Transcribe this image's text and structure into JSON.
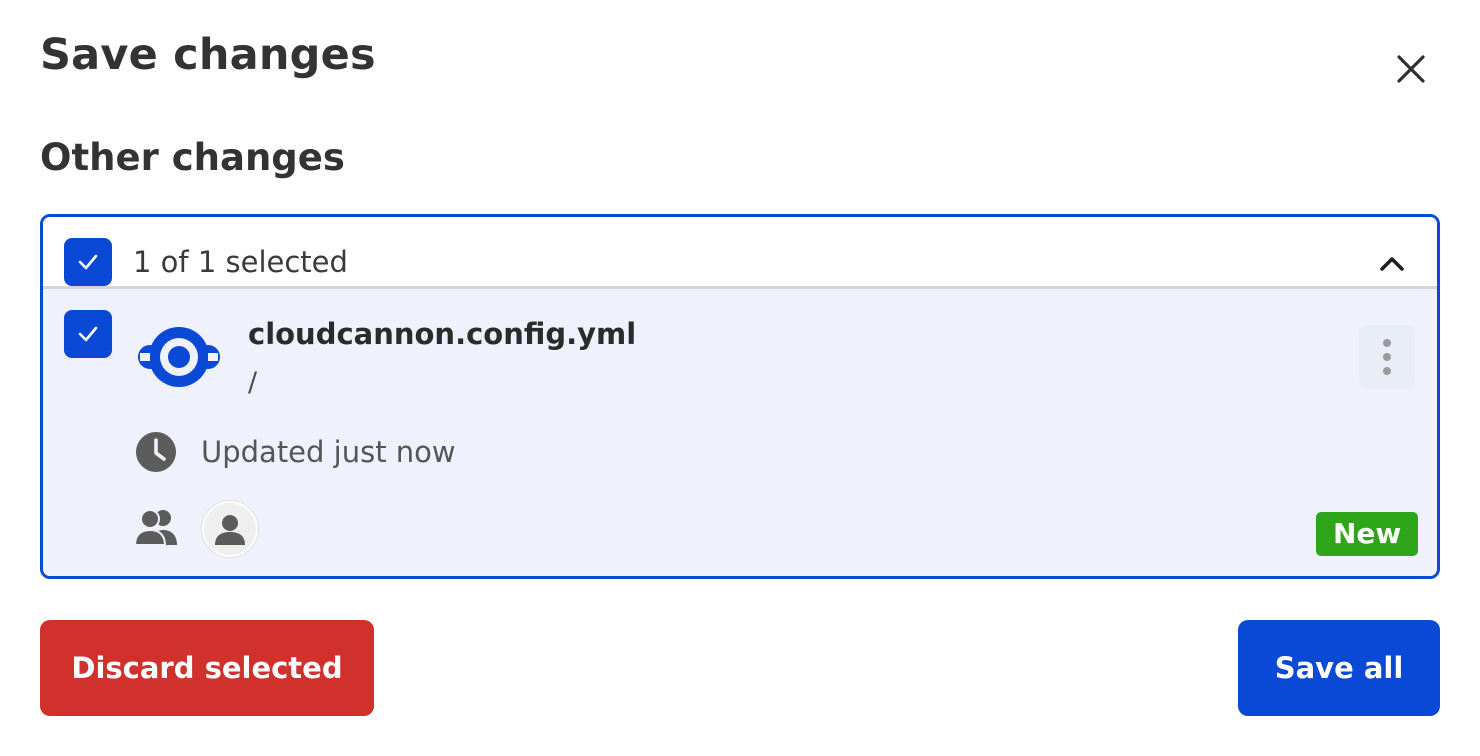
{
  "dialog": {
    "title": "Save changes",
    "section_title": "Other changes"
  },
  "panel": {
    "selected_text": "1 of 1 selected",
    "header_checked": true
  },
  "file": {
    "name": "cloudcannon.config.yml",
    "path": "/",
    "checked": true,
    "updated": "Updated just now",
    "badge": "New",
    "icon": "cloudcannon-logo-icon"
  },
  "actions": {
    "discard_label": "Discard selected",
    "save_label": "Save all"
  },
  "colors": {
    "accent": "#0a48d6",
    "danger": "#d0312d",
    "badge_green": "#2fa51a",
    "row_bg": "#eff2fc"
  }
}
